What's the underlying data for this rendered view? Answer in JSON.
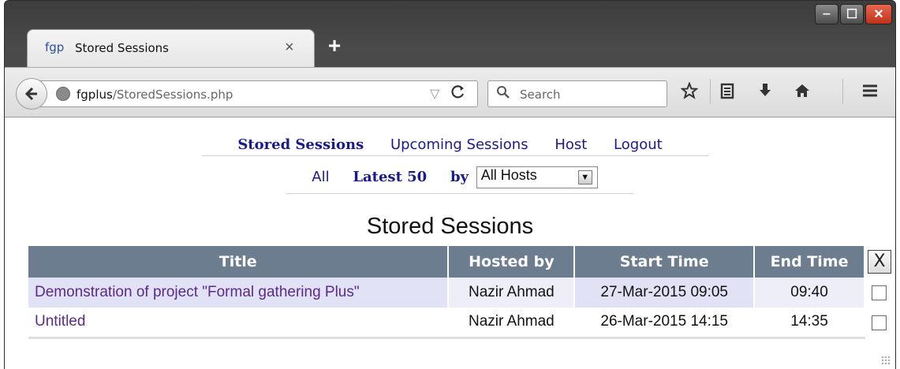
{
  "tab": {
    "favicon": "fgp",
    "title": "Stored Sessions",
    "close": "×",
    "new": "+"
  },
  "window_controls": {
    "minimize": "‒",
    "maximize": "☐",
    "close": "✕"
  },
  "navbar": {
    "url_host": "fgplus",
    "url_path": "/StoredSessions.php",
    "search_placeholder": "Search",
    "dropdown_glyph": "▽",
    "reload_glyph": "C"
  },
  "nav": {
    "links": [
      "Stored Sessions",
      "Upcoming Sessions",
      "Host",
      "Logout"
    ],
    "active": "Stored Sessions"
  },
  "filter": {
    "all_label": "All",
    "latest_label": "Latest 50",
    "by_label": "by",
    "host_selected": "All Hosts"
  },
  "page_title": "Stored Sessions",
  "table": {
    "headers": [
      "Title",
      "Hosted by",
      "Start Time",
      "End Time"
    ],
    "delete_header": "X",
    "rows": [
      {
        "title": "Demonstration of project \"Formal gathering Plus\"",
        "hosted_by": "Nazir Ahmad",
        "start": "27-Mar-2015 09:05",
        "end": "09:40",
        "checked": false
      },
      {
        "title": "Untitled",
        "hosted_by": "Nazir Ahmad",
        "start": "26-Mar-2015 14:15",
        "end": "14:35",
        "checked": false
      }
    ]
  },
  "icons": [
    "back-arrow-icon",
    "globe-icon",
    "reload-icon",
    "search-icon",
    "bookmark-star-icon",
    "reading-list-icon",
    "download-icon",
    "home-icon",
    "menu-icon"
  ]
}
